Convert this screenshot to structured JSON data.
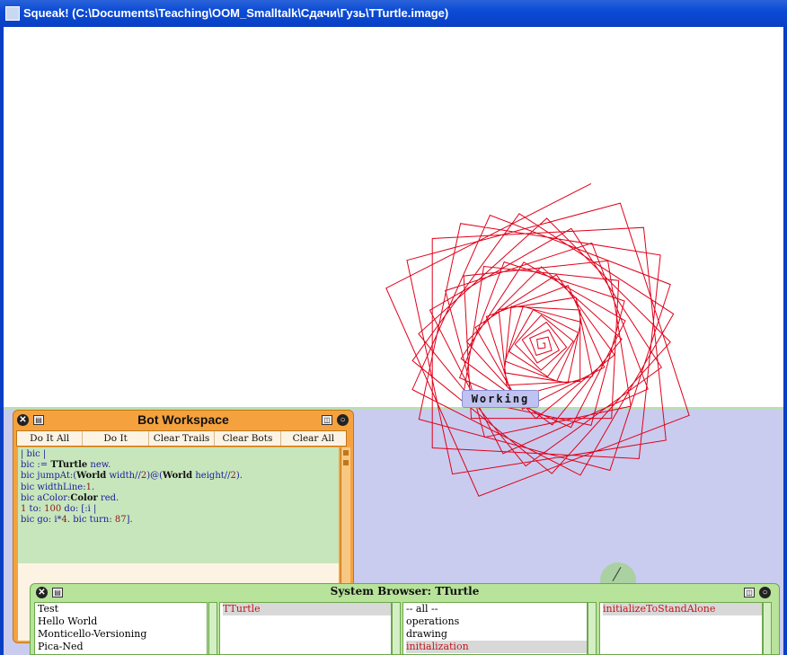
{
  "window": {
    "title": "Squeak! (C:\\Documents\\Teaching\\OOM_Smalltalk\\Сдачи\\Гузь\\TTurtle.image)"
  },
  "status": {
    "working_label": "Working"
  },
  "workspace": {
    "title": "Bot Workspace",
    "buttons": [
      "Do It All",
      "Do It",
      "Clear Trails",
      "Clear Bots",
      "Clear All"
    ],
    "code": {
      "l1": "| bic |",
      "l2_a": "bic := ",
      "l2_b": "TTurtle",
      "l2_c": " new.",
      "l3_a": "bic jumpAt:(",
      "l3_b": "World",
      "l3_c": " width//",
      "l3_d": "2",
      "l3_e": ")@(",
      "l3_f": "World",
      "l3_g": " height//",
      "l3_h": "2",
      "l3_i": ").",
      "l4_a": "bic widthLine:",
      "l4_b": "1",
      "l4_c": ".",
      "l5_a": "bic aColor:",
      "l5_b": "Color",
      "l5_c": " red.",
      "l6_a": "1",
      "l6_b": " to: ",
      "l6_c": "100",
      "l6_d": " do: [:i |",
      "l7_a": "bic go: i*",
      "l7_b": "4",
      "l7_c": ". bic turn: ",
      "l7_d": "87",
      "l7_e": "]."
    }
  },
  "browser": {
    "title": "System Browser: TTurtle",
    "categories": [
      "Test",
      "Hello World",
      "Monticello-Versioning",
      "Pica-Ned"
    ],
    "classes": [
      "TTurtle"
    ],
    "protocols": [
      "-- all --",
      "operations",
      "drawing",
      "initialization"
    ],
    "methods": [
      "initializeToStandAlone"
    ]
  },
  "colors": {
    "trail": "#e0001a",
    "workspace_frame": "#f5a23e",
    "browser_frame": "#b8e39a",
    "lower_pane": "#c9ccef"
  },
  "turtle": {
    "steps": 100,
    "step_multiplier": 4,
    "turn_degrees": 87
  }
}
